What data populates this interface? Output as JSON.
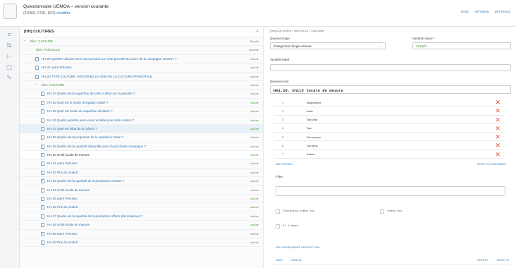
{
  "header": {
    "title": "Questionnaire UEMOA – version courante",
    "subtitle_meta": "(19360, FOE, IER)",
    "subtitle_link": "modifier",
    "actions": [
      "Save",
      "Options",
      "Settings"
    ]
  },
  "rail": {
    "icons": [
      "list-icon",
      "tree-icon",
      "branch-icon",
      "page-icon",
      "pencil-icon"
    ]
  },
  "tree": {
    "title": "[HH] CULTURES",
    "rows": [
      {
        "kind": "block",
        "label": "Bloc: CULTURE",
        "tag": "Rosafil",
        "indent": 0
      },
      {
        "kind": "block",
        "label": "Bloc: PARCELLE",
        "tag": "parcelle",
        "indent": 1
      },
      {
        "kind": "q",
        "label": "HH.20 Quelles cultures avez-vous produit sur cette parcelle au cours de la campagne 2016/17 ?",
        "tag": "culture",
        "indent": 2
      },
      {
        "kind": "q",
        "label": "HH.21 autre Précisez",
        "tag": "culture",
        "indent": 2
      },
      {
        "kind": "q",
        "label": "HH.22 TYPE CULTURE: INSCRIVEZ LE NOM DE LA CULTURE PRINCIPALE",
        "tag": "culture",
        "indent": 2
      },
      {
        "kind": "block",
        "label": "Bloc: CULTURE",
        "tag": "culture",
        "indent": 2
      },
      {
        "kind": "q",
        "label": "HH.23 Quelle est la superficie de cette culture sur la parcelle ?",
        "tag": "culture",
        "indent": 3
      },
      {
        "kind": "q",
        "label": "HH.24 Quel est le mode d'irrigation utilisé ?",
        "tag": "culture",
        "indent": 3
      },
      {
        "kind": "q",
        "label": "HH.25 Quel est l'unité de superficie déclarée ?",
        "tag": "culture",
        "indent": 3
      },
      {
        "kind": "q",
        "label": "HH.26 Quelle quantité avez-vous récoltée pour cette culture ?",
        "tag": "culture",
        "indent": 3
      },
      {
        "kind": "q",
        "label": "HH.27 Quel est l'état de la culture ?",
        "tag": "culture",
        "indent": 3
      },
      {
        "kind": "q",
        "label": "HH.28 Quelle est la proportion de la superficie totale ?",
        "tag": "culture",
        "indent": 3
      },
      {
        "kind": "q",
        "label": "HH.29 Quelle est la quantité disponible pour la prochaine campagne ?",
        "tag": "culture",
        "indent": 3
      },
      {
        "kind": "q",
        "label": "HH.30 Unité locale de mesure",
        "tag": "culture",
        "indent": 3,
        "selected": true
      },
      {
        "kind": "q",
        "label": "HH.31 autre Précisez",
        "tag": "culture",
        "indent": 3
      },
      {
        "kind": "q",
        "label": "HH.32 Prix du produit",
        "tag": "culture",
        "indent": 3
      },
      {
        "kind": "q",
        "label": "HH.33 Quelle est la quantité de la production vendue ?",
        "tag": "culture",
        "indent": 3
      },
      {
        "kind": "q",
        "label": "HH.34 Unité locale de mesure",
        "tag": "culture",
        "indent": 3
      },
      {
        "kind": "q",
        "label": "HH.35 autre Précisez",
        "tag": "culture",
        "indent": 3
      },
      {
        "kind": "q",
        "label": "HH.36 Prix du produit",
        "tag": "culture",
        "indent": 3
      },
      {
        "kind": "q",
        "label": "HH.37 Quelle est la quantité de la production offerte (don/cadeau) ?",
        "tag": "culture",
        "indent": 3
      },
      {
        "kind": "q",
        "label": "HH.38 Unité locale de mesure",
        "tag": "culture",
        "indent": 3
      },
      {
        "kind": "q",
        "label": "HH.39 autre Précisez",
        "tag": "culture",
        "indent": 3
      },
      {
        "kind": "q",
        "label": "HH.40 Prix du produit",
        "tag": "culture",
        "indent": 3
      }
    ]
  },
  "editor": {
    "breadcrumb": "[HH] CULTURES › PARCELLE › CULTURE",
    "question_type_label": "Question type",
    "question_type_value": "Categorical: Single-answer",
    "variable_name_label": "Variable name *",
    "variable_name_value": "s10q20",
    "variable_label_label": "Variable label",
    "variable_label_value": "",
    "question_text_label": "Question text",
    "question_text_value": "HH1.20. Unité locale de mesure",
    "answers": [
      {
        "code": "1",
        "text": "kilogramme"
      },
      {
        "code": "2",
        "text": "botte"
      },
      {
        "code": "3",
        "text": "Tas/Vrac"
      },
      {
        "code": "4",
        "text": "Sac"
      },
      {
        "code": "5",
        "text": "Sac moyen"
      },
      {
        "code": "6",
        "text": "Sac gros"
      },
      {
        "code": "7",
        "text": "Autres"
      }
    ],
    "add_option_link": "Add option",
    "move_link": "Move to cascading",
    "filter_label": "Filter",
    "checkboxes": [
      {
        "label": "Cascading combo box"
      },
      {
        "label": "Combo box"
      },
      {
        "label": "Is linked"
      }
    ],
    "instructions_link": "Add interviewer instruction",
    "bottom_left": [
      "Save",
      "Cancel"
    ],
    "bottom_right": [
      "Delete",
      "Move to"
    ]
  },
  "colors": {
    "link": "#2a7ab8",
    "green": "#4a9a3a",
    "delete": "#e05a4f"
  }
}
